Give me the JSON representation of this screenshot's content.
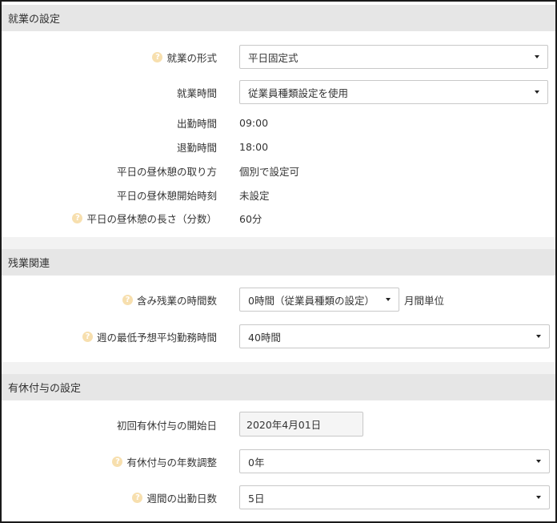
{
  "sections": {
    "work": "就業の設定",
    "overtime": "残業関連",
    "paid_leave": "有休付与の設定"
  },
  "work": {
    "format": {
      "label": "就業の形式",
      "value": "平日固定式"
    },
    "hours": {
      "label": "就業時間",
      "value": "従業員種類設定を使用"
    },
    "start": {
      "label": "出勤時間",
      "value": "09:00"
    },
    "end": {
      "label": "退勤時間",
      "value": "18:00"
    },
    "lunch_mode": {
      "label": "平日の昼休憩の取り方",
      "value": "個別で設定可"
    },
    "lunch_start": {
      "label": "平日の昼休憩開始時刻",
      "value": "未設定"
    },
    "lunch_length": {
      "label": "平日の昼休憩の長さ（分数）",
      "value": "60分"
    }
  },
  "overtime": {
    "included": {
      "label": "含み残業の時間数",
      "value": "0時間（従業員種類の設定）",
      "unit": "月間単位"
    },
    "weekly_min": {
      "label": "週の最低予想平均勤務時間",
      "value": "40時間"
    }
  },
  "paid_leave": {
    "first_grant": {
      "label": "初回有休付与の開始日",
      "value": "2020年4月01日"
    },
    "years_adjust": {
      "label": "有休付与の年数調整",
      "value": "0年"
    },
    "weekly_days": {
      "label": "週間の出勤日数",
      "value": "5日"
    }
  },
  "help_glyph": "?",
  "colors": {
    "header_bg": "#e6e6e6",
    "help_icon": "#f7dfae",
    "gap_bg": "#f2f2f2"
  }
}
